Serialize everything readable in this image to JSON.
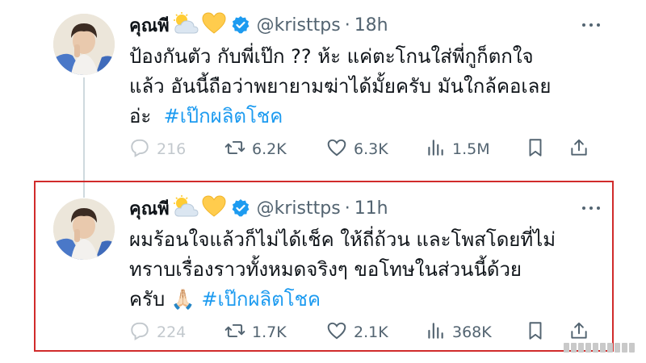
{
  "tweets": [
    {
      "display_name": "คุณพี",
      "emojis": [
        "sun-behind-cloud-icon",
        "yellow-heart-icon"
      ],
      "verified": true,
      "handle": "@kristtps",
      "separator": "·",
      "time": "18h",
      "text_lines": [
        "ป้องกันตัว กับพี่เป๊ก ?? ห้ะ แค่ตะโกนใส่พี่กูก็ตกใจ",
        "แล้ว อันนี้ถือว่าพยายามฆ่าได้มั้ยครับ มันใกล้คอเลย",
        "อ่ะ"
      ],
      "hashtag": "#เป๊กผลิตโชค",
      "stats": {
        "replies": "216",
        "reposts": "6.2K",
        "likes": "6.3K",
        "views": "1.5M"
      }
    },
    {
      "display_name": "คุณพี",
      "emojis": [
        "sun-behind-cloud-icon",
        "yellow-heart-icon"
      ],
      "verified": true,
      "handle": "@kristtps",
      "separator": "·",
      "time": "11h",
      "text_lines": [
        "ผมร้อนใจแล้วก็ไม่ได้เช็ค ให้ถี่ถ้วน และโพสโดยที่ไม่",
        "ทราบเรื่องราวทั้งหมดจริงๆ ขอโทษในส่วนนี้ด้วย",
        "ครับ"
      ],
      "inline_emoji": "🙏🏻",
      "hashtag": "#เป๊กผลิตโชค",
      "stats": {
        "replies": "224",
        "reposts": "1.7K",
        "likes": "2.1K",
        "views": "368K"
      }
    }
  ],
  "colors": {
    "accent_blue": "#1d9bf0",
    "verified_blue": "#1d9bf0",
    "muted_text": "#536471",
    "highlight_border": "#d12b2b"
  }
}
